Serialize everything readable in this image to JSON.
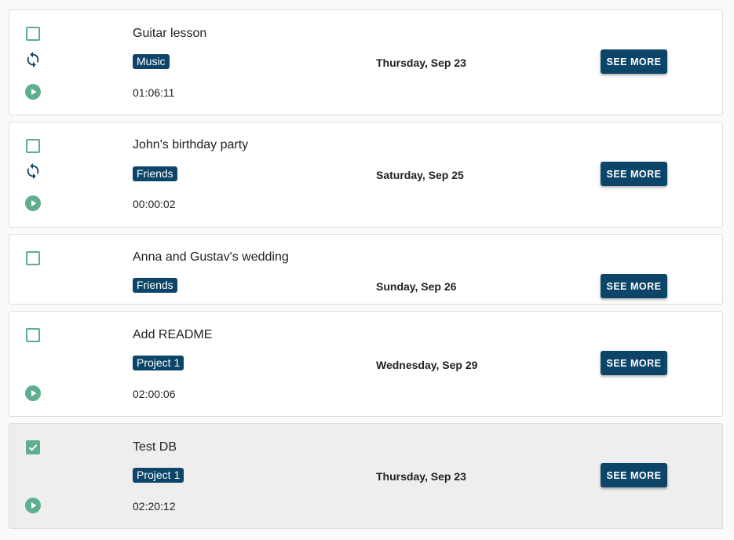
{
  "colors": {
    "accent_green": "#5fae8e",
    "button_bg": "#0d4569",
    "tag_bg": "#0d4569",
    "done_card_bg": "#eeeeee"
  },
  "tasks": [
    {
      "title": "Guitar lesson",
      "tag": "Music",
      "date": "Thursday, Sep 23",
      "time": "01:06:11",
      "checked": false,
      "repeat": true,
      "button_label": "SEE MORE"
    },
    {
      "title": "John's birthday party",
      "tag": "Friends",
      "date": "Saturday, Sep 25",
      "time": "00:00:02",
      "checked": false,
      "repeat": true,
      "button_label": "SEE MORE"
    },
    {
      "title": "Anna and Gustav's wedding",
      "tag": "Friends",
      "date": "Sunday, Sep 26",
      "checked": false,
      "repeat": false,
      "button_label": "SEE MORE"
    },
    {
      "title": "Add README",
      "tag": "Project 1",
      "date": "Wednesday, Sep 29",
      "time": "02:00:06",
      "checked": false,
      "repeat": false,
      "button_label": "SEE MORE"
    },
    {
      "title": "Test DB",
      "tag": "Project 1",
      "date": "Thursday, Sep 23",
      "time": "02:20:12",
      "checked": true,
      "repeat": false,
      "button_label": "SEE MORE"
    }
  ]
}
